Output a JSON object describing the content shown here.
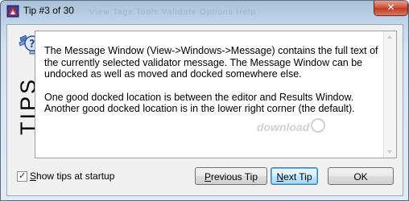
{
  "window": {
    "title": "Tip #3 of 30",
    "close_label": "✕",
    "faded_menu": "View   Tags   Tools   Validate   Options   Help"
  },
  "sidebar": {
    "icon": "lightbulb-question-icon",
    "label": "TIPS"
  },
  "tip": {
    "paragraph_1": "The Message Window (View->Windows->Message) contains the full text of the currently selected validator message. The Message Window can be undocked as well as moved and docked somewhere else.",
    "paragraph_2": "One good docked location is between the editor and Results Window. Another good docked location is in the lower right corner (the default)."
  },
  "watermark": "download",
  "startup": {
    "checked": true,
    "label_accel": "S",
    "label_rest": "how tips at startup"
  },
  "buttons": {
    "previous_accel": "P",
    "previous_rest": "revious Tip",
    "next_accel": "N",
    "next_rest": "ext Tip",
    "ok": "OK"
  },
  "colors": {
    "title_gradient_top": "#a9c1da",
    "close_red": "#c23a22",
    "default_button_border": "#3c7fb1"
  }
}
